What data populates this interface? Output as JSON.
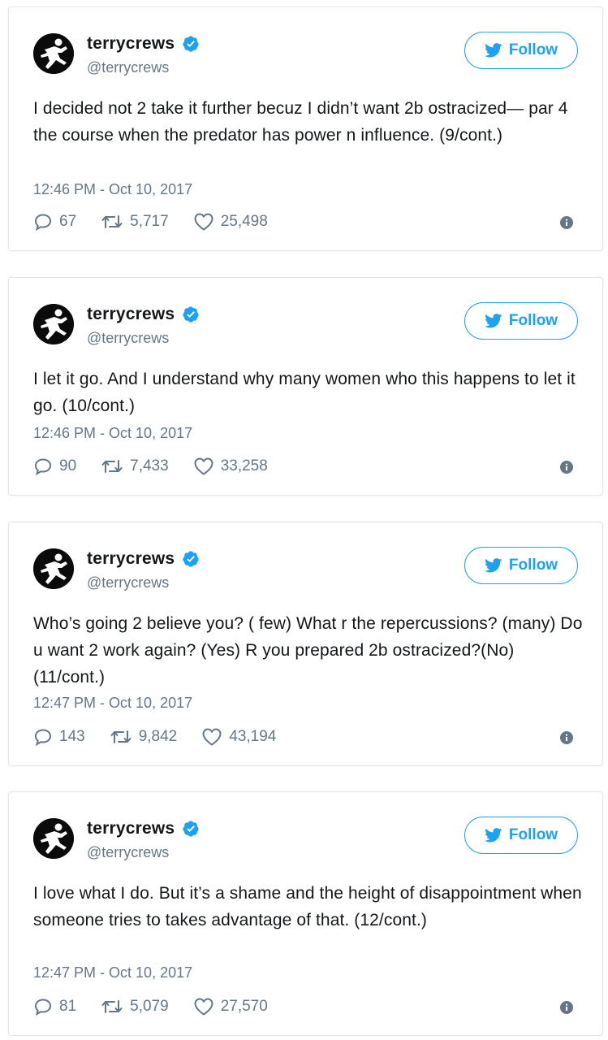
{
  "colors": {
    "accent": "#1da1f2",
    "text": "#14171a",
    "secondary_text": "#657786",
    "border": "#e1e8ed"
  },
  "tweets": [
    {
      "display_name": "terrycrews",
      "handle": "@terrycrews",
      "follow_label": "Follow",
      "text": "I decided not 2 take it further becuz I didn’t want 2b ostracized— par 4 the course when the predator has power n influence. (9/cont.)",
      "timestamp": "12:46 PM - Oct 10, 2017",
      "replies": "67",
      "retweets": "5,717",
      "likes": "25,498"
    },
    {
      "display_name": "terrycrews",
      "handle": "@terrycrews",
      "follow_label": "Follow",
      "text": "I let it go. And I understand why many women who this happens to let it go. (10/cont.)",
      "timestamp": "12:46 PM - Oct 10, 2017",
      "replies": "90",
      "retweets": "7,433",
      "likes": "33,258"
    },
    {
      "display_name": "terrycrews",
      "handle": "@terrycrews",
      "follow_label": "Follow",
      "text": "Who’s going 2 believe you? ( few) What r the repercussions? (many) Do u want 2 work again? (Yes) R you prepared 2b ostracized?(No)(11/cont.)",
      "timestamp": "12:47 PM - Oct 10, 2017",
      "replies": "143",
      "retweets": "9,842",
      "likes": "43,194"
    },
    {
      "display_name": "terrycrews",
      "handle": "@terrycrews",
      "follow_label": "Follow",
      "text": "I love what I do. But it’s a shame and the height of disappointment when someone tries to takes advantage of that. (12/cont.)",
      "timestamp": "12:47 PM - Oct 10, 2017",
      "replies": "81",
      "retweets": "5,079",
      "likes": "27,570"
    }
  ]
}
